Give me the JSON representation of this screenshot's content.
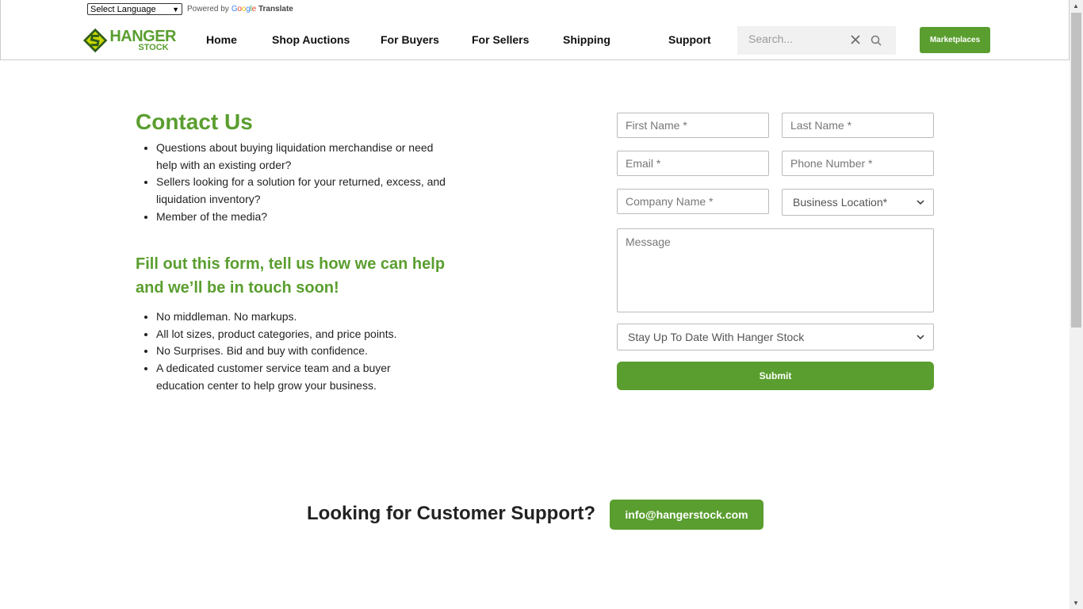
{
  "translate": {
    "select_label": "Select Language",
    "powered_by": "Powered by",
    "google": "Google",
    "translate_label": "Translate"
  },
  "logo": {
    "main": "HANGER",
    "sub": "STOCK"
  },
  "nav": {
    "items": [
      "Home",
      "Shop Auctions",
      "For Buyers",
      "For Sellers",
      "Shipping",
      "Support"
    ]
  },
  "search": {
    "placeholder": "Search..."
  },
  "marketplaces_label": "Marketplaces",
  "contact": {
    "title": "Contact Us",
    "questions": [
      "Questions about buying liquidation merchandise or need help with an existing order?",
      "Sellers looking for a solution for your returned, excess, and liquidation inventory?",
      "Member of the media?"
    ],
    "subheading": "Fill out this form, tell us how we can help and we’ll be in touch soon!",
    "benefits": [
      "No middleman. No markups.",
      "All lot sizes, product categories, and price points.",
      "No Surprises. Bid and buy with confidence.",
      "A dedicated customer service team and a buyer education center to help grow your business."
    ]
  },
  "form": {
    "first_name": "First Name *",
    "last_name": "Last Name *",
    "email": "Email *",
    "phone": "Phone Number *",
    "company": "Company Name *",
    "location": "Business Location*",
    "message": "Message",
    "newsletter": "Stay Up To Date With Hanger Stock",
    "submit": "Submit"
  },
  "support": {
    "title": "Looking for Customer Support?",
    "email": "info@hangerstock.com"
  },
  "colors": {
    "brand_green": "#5a9e2f"
  }
}
